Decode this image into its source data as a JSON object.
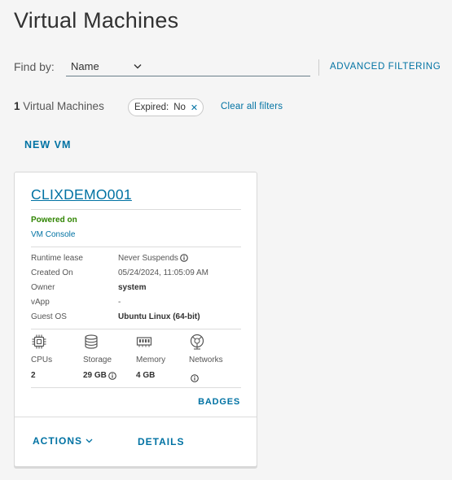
{
  "page": {
    "title": "Virtual Machines"
  },
  "filter": {
    "find_by_label": "Find by:",
    "find_by_value": "Name",
    "advanced_label": "ADVANCED FILTERING"
  },
  "results": {
    "count": "1",
    "count_suffix": " Virtual Machines",
    "chip_key": "Expired:",
    "chip_value": "No",
    "clear_label": "Clear all filters"
  },
  "toolbar": {
    "new_vm_label": "NEW VM"
  },
  "vm_card": {
    "name": "CLIXDEMO001",
    "power_state": "Powered on",
    "console_label": "VM Console",
    "properties": [
      {
        "label": "Runtime lease",
        "value": "Never Suspends"
      },
      {
        "label": "Created On",
        "value": "05/24/2024, 11:05:09 AM"
      },
      {
        "label": "Owner",
        "value": "system"
      },
      {
        "label": "vApp",
        "value": "-"
      },
      {
        "label": "Guest OS",
        "value": "Ubuntu Linux (64-bit)"
      }
    ],
    "resources": [
      {
        "label": "CPUs",
        "value": "2",
        "icon": "cpu-icon"
      },
      {
        "label": "Storage",
        "value": "29 GB",
        "icon": "storage-icon"
      },
      {
        "label": "Memory",
        "value": "4 GB",
        "icon": "memory-icon"
      },
      {
        "label": "Networks",
        "value": "",
        "icon": "network-icon"
      }
    ],
    "badges_label": "BADGES",
    "actions_label": "ACTIONS",
    "details_label": "DETAILS"
  },
  "colors": {
    "link": "#0072a3",
    "powered_on": "#2f8400",
    "background": "#f5f5f5"
  }
}
